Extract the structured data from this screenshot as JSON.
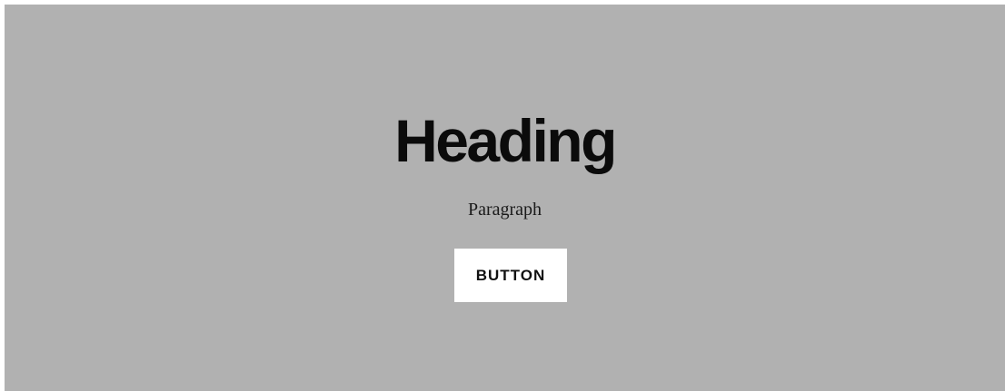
{
  "hero": {
    "heading": "Heading",
    "paragraph": "Paragraph",
    "button_label": "BUTTON",
    "background_color": "#b1b1b1",
    "button_color": "#ffffff"
  }
}
